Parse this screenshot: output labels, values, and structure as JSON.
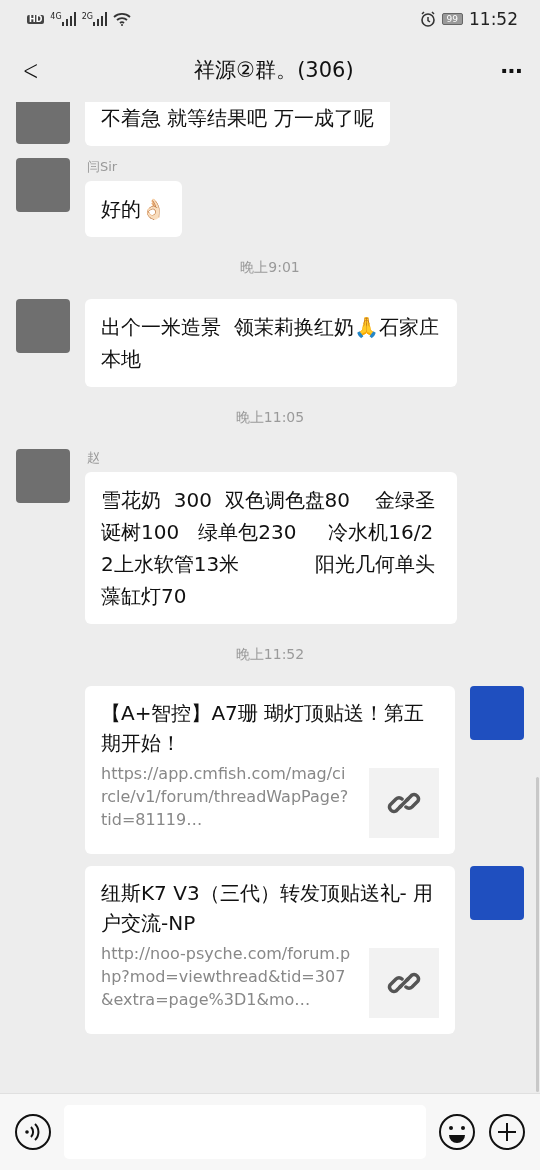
{
  "status_bar": {
    "network_labels": [
      "HD",
      "4G",
      "2G"
    ],
    "battery": "99",
    "time": "11:52"
  },
  "header": {
    "back": "<",
    "title": "祥源②群。(306)",
    "more": "···"
  },
  "messages": [
    {
      "kind": "text",
      "outgoing": false,
      "text": "不着急 就等结果吧 万一成了呢"
    },
    {
      "kind": "text",
      "outgoing": false,
      "sender": "闫Sir",
      "text": "好的👌🏻"
    },
    {
      "kind": "time",
      "text": "晚上9:01"
    },
    {
      "kind": "text",
      "outgoing": false,
      "text": "出个一米造景  领茉莉换红奶🙏石家庄本地"
    },
    {
      "kind": "time",
      "text": "晚上11:05"
    },
    {
      "kind": "text",
      "outgoing": false,
      "sender": "赵",
      "text": "雪花奶  300  双色调色盘80    金绿圣诞树100   绿单包230     冷水机16/22上水软管13米            阳光几何单头藻缸灯70"
    },
    {
      "kind": "time",
      "text": "晚上11:52"
    },
    {
      "kind": "link",
      "outgoing": true,
      "title": "【A+智控】A7珊 瑚灯顶贴送！第五期开始！",
      "url": "https://app.cmfish.com/mag/circle/v1/forum/threadWapPage?tid=81119…"
    },
    {
      "kind": "link",
      "outgoing": true,
      "title": "纽斯K7 V3（三代）转发顶贴送礼- 用户交流-NP",
      "url": "http://noo-psyche.com/forum.php?mod=viewthread&tid=307&extra=page%3D1&mo…"
    }
  ]
}
